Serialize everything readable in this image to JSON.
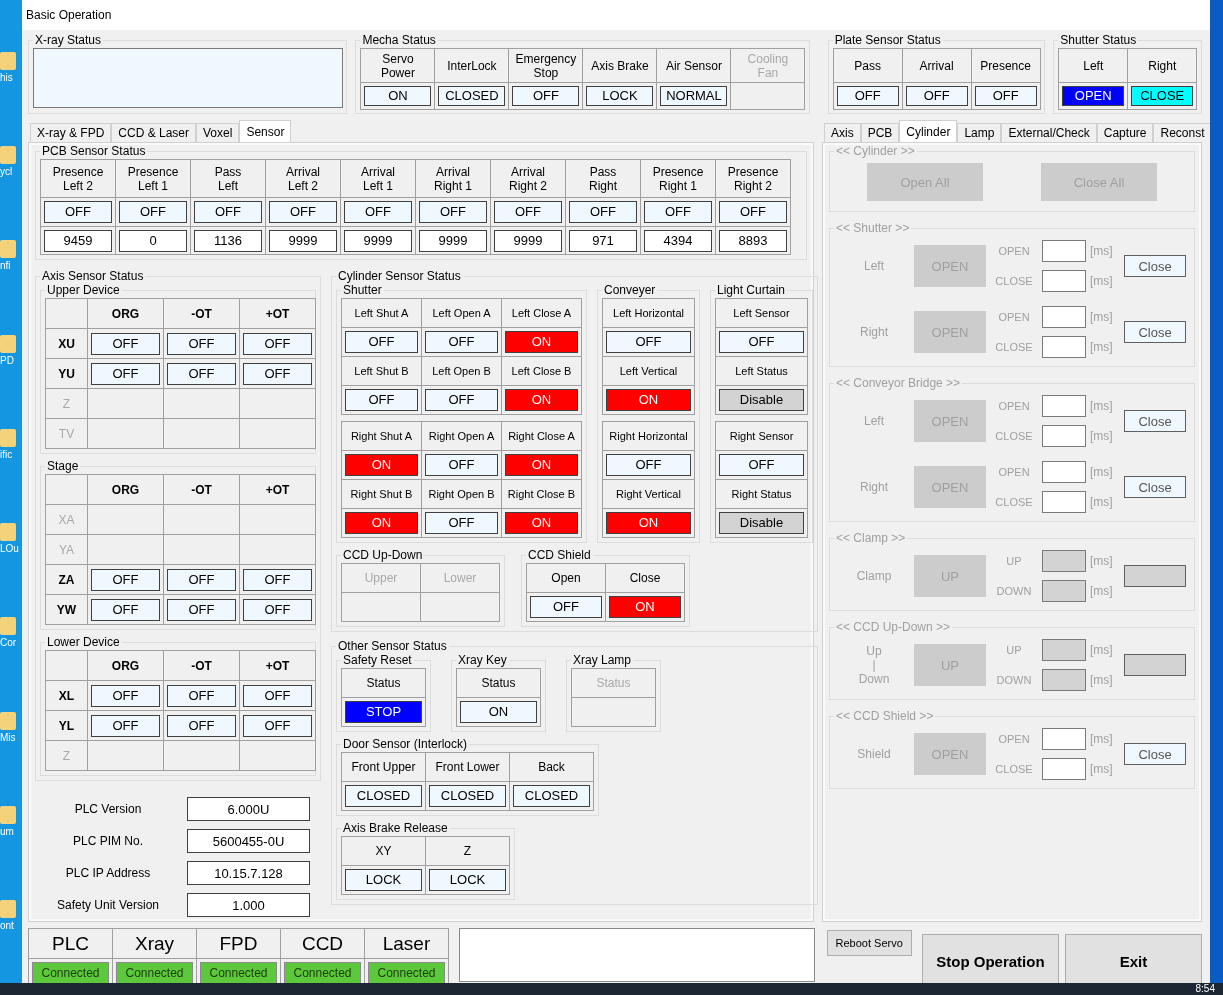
{
  "window": {
    "title": "Basic Operation"
  },
  "desktop": {
    "icon_labels": [
      "his",
      "ycl",
      "nfi",
      "PD",
      "ific",
      "LOu",
      "Cor",
      "Mis",
      "um",
      "ont"
    ]
  },
  "xray_status": {
    "title": "X-ray Status"
  },
  "mecha_status": {
    "title": "Mecha Status",
    "columns": [
      {
        "label": "Servo\nPower",
        "disabled": false,
        "indicator": {
          "text": "ON",
          "color": "#f0f8ff"
        }
      },
      {
        "label": "InterLock",
        "disabled": false,
        "indicator": {
          "text": "CLOSED",
          "color": "#f0f8ff"
        }
      },
      {
        "label": "Emergency\nStop",
        "disabled": false,
        "indicator": {
          "text": "OFF",
          "color": "#f0f8ff"
        }
      },
      {
        "label": "Axis Brake",
        "disabled": false,
        "indicator": {
          "text": "LOCK",
          "color": "#f0f8ff"
        }
      },
      {
        "label": "Air Sensor",
        "disabled": false,
        "indicator": {
          "text": "NORMAL",
          "color": "#f0f8ff"
        }
      },
      {
        "label": "Cooling\nFan",
        "disabled": true
      }
    ]
  },
  "plate_sensor_status": {
    "title": "Plate Sensor Status",
    "columns": [
      {
        "label": "Pass",
        "indicator": {
          "text": "OFF",
          "color": "#f0f8ff"
        }
      },
      {
        "label": "Arrival",
        "indicator": {
          "text": "OFF",
          "color": "#f0f8ff"
        }
      },
      {
        "label": "Presence",
        "indicator": {
          "text": "OFF",
          "color": "#f0f8ff"
        }
      }
    ]
  },
  "shutter_status": {
    "title": "Shutter Status",
    "columns": [
      {
        "label": "Left",
        "indicator": {
          "text": "OPEN",
          "color": "#0000ff"
        }
      },
      {
        "label": "Right",
        "indicator": {
          "text": "CLOSE",
          "color": "#00ffff"
        }
      }
    ]
  },
  "left_tabs": [
    {
      "label": "X-ray & FPD",
      "selected": false
    },
    {
      "label": "CCD & Laser",
      "selected": false
    },
    {
      "label": "Voxel",
      "selected": false
    },
    {
      "label": "Sensor",
      "selected": true
    }
  ],
  "pcb_sensor_status": {
    "title": "PCB Sensor Status",
    "columns": [
      {
        "label": "Presence\nLeft 2",
        "indicator": {
          "text": "OFF",
          "color": "#f0f8ff"
        },
        "value": "9459"
      },
      {
        "label": "Presence\nLeft 1",
        "indicator": {
          "text": "OFF",
          "color": "#f0f8ff"
        },
        "value": "0"
      },
      {
        "label": "Pass\nLeft",
        "indicator": {
          "text": "OFF",
          "color": "#f0f8ff"
        },
        "value": "1136"
      },
      {
        "label": "Arrival\nLeft 2",
        "indicator": {
          "text": "OFF",
          "color": "#f0f8ff"
        },
        "value": "9999"
      },
      {
        "label": "Arrival\nLeft 1",
        "indicator": {
          "text": "OFF",
          "color": "#f0f8ff"
        },
        "value": "9999"
      },
      {
        "label": "Arrival\nRight 1",
        "indicator": {
          "text": "OFF",
          "color": "#f0f8ff"
        },
        "value": "9999"
      },
      {
        "label": "Arrival\nRight 2",
        "indicator": {
          "text": "OFF",
          "color": "#f0f8ff"
        },
        "value": "9999"
      },
      {
        "label": "Pass\nRight",
        "indicator": {
          "text": "OFF",
          "color": "#f0f8ff"
        },
        "value": "971"
      },
      {
        "label": "Presence\nRight 1",
        "indicator": {
          "text": "OFF",
          "color": "#f0f8ff"
        },
        "value": "4394"
      },
      {
        "label": "Presence\nRight 2",
        "indicator": {
          "text": "OFF",
          "color": "#f0f8ff"
        },
        "value": "8893"
      }
    ]
  },
  "axis_sensor_status": {
    "title": "Axis Sensor Status",
    "groups": [
      {
        "title": "Upper Device",
        "headers": [
          "ORG",
          "-OT",
          "+OT"
        ],
        "rows": [
          {
            "axis": "XU",
            "disabled": false,
            "values": [
              {
                "text": "OFF",
                "color": "#f0f8ff"
              },
              {
                "text": "OFF",
                "color": "#f0f8ff"
              },
              {
                "text": "OFF",
                "color": "#f0f8ff"
              }
            ]
          },
          {
            "axis": "YU",
            "disabled": false,
            "values": [
              {
                "text": "OFF",
                "color": "#f0f8ff"
              },
              {
                "text": "OFF",
                "color": "#f0f8ff"
              },
              {
                "text": "OFF",
                "color": "#f0f8ff"
              }
            ]
          },
          {
            "axis": "Z",
            "disabled": true
          },
          {
            "axis": "TV",
            "disabled": true
          }
        ]
      },
      {
        "title": "Stage",
        "headers": [
          "ORG",
          "-OT",
          "+OT"
        ],
        "rows": [
          {
            "axis": "XA",
            "disabled": true
          },
          {
            "axis": "YA",
            "disabled": true
          },
          {
            "axis": "ZA",
            "disabled": false,
            "values": [
              {
                "text": "OFF",
                "color": "#f0f8ff"
              },
              {
                "text": "OFF",
                "color": "#f0f8ff"
              },
              {
                "text": "OFF",
                "color": "#f0f8ff"
              }
            ]
          },
          {
            "axis": "YW",
            "disabled": false,
            "values": [
              {
                "text": "OFF",
                "color": "#f0f8ff"
              },
              {
                "text": "OFF",
                "color": "#f0f8ff"
              },
              {
                "text": "OFF",
                "color": "#f0f8ff"
              }
            ]
          }
        ]
      },
      {
        "title": "Lower Device",
        "headers": [
          "ORG",
          "-OT",
          "+OT"
        ],
        "rows": [
          {
            "axis": "XL",
            "disabled": false,
            "values": [
              {
                "text": "OFF",
                "color": "#f0f8ff"
              },
              {
                "text": "OFF",
                "color": "#f0f8ff"
              },
              {
                "text": "OFF",
                "color": "#f0f8ff"
              }
            ]
          },
          {
            "axis": "YL",
            "disabled": false,
            "values": [
              {
                "text": "OFF",
                "color": "#f0f8ff"
              },
              {
                "text": "OFF",
                "color": "#f0f8ff"
              },
              {
                "text": "OFF",
                "color": "#f0f8ff"
              }
            ]
          },
          {
            "axis": "Z",
            "disabled": true
          }
        ]
      }
    ]
  },
  "plc_info": [
    {
      "label": "PLC Version",
      "value": "6.000U"
    },
    {
      "label": "PLC PIM No.",
      "value": "5600455-0U"
    },
    {
      "label": "PLC IP Address",
      "value": "10.15.7.128"
    },
    {
      "label": "Safety Unit Version",
      "value": "1.000"
    }
  ],
  "cylinder_sensor_status": {
    "title": "Cylinder Sensor Status",
    "groups": [
      {
        "title": "Shutter",
        "blocks": [
          [
            [
              {
                "label": "Left Shut A",
                "indicator": {
                  "text": "OFF",
                  "color": "#f0f8ff"
                }
              },
              {
                "label": "Left Open A",
                "indicator": {
                  "text": "OFF",
                  "color": "#f0f8ff"
                }
              },
              {
                "label": "Left Close A",
                "indicator": {
                  "text": "ON",
                  "color": "#ff0000"
                }
              }
            ],
            [
              {
                "label": "Left Shut B",
                "indicator": {
                  "text": "OFF",
                  "color": "#f0f8ff"
                }
              },
              {
                "label": "Left Open B",
                "indicator": {
                  "text": "OFF",
                  "color": "#f0f8ff"
                }
              },
              {
                "label": "Left Close B",
                "indicator": {
                  "text": "ON",
                  "color": "#ff0000"
                }
              }
            ]
          ],
          [
            [
              {
                "label": "Right Shut A",
                "indicator": {
                  "text": "ON",
                  "color": "#ff0000"
                }
              },
              {
                "label": "Right Open A",
                "indicator": {
                  "text": "OFF",
                  "color": "#f0f8ff"
                }
              },
              {
                "label": "Right Close A",
                "indicator": {
                  "text": "ON",
                  "color": "#ff0000"
                }
              }
            ],
            [
              {
                "label": "Right Shut B",
                "indicator": {
                  "text": "ON",
                  "color": "#ff0000"
                }
              },
              {
                "label": "Right Open B",
                "indicator": {
                  "text": "OFF",
                  "color": "#f0f8ff"
                }
              },
              {
                "label": "Right Close B",
                "indicator": {
                  "text": "ON",
                  "color": "#ff0000"
                }
              }
            ]
          ]
        ]
      },
      {
        "title": "Conveyer",
        "blocks": [
          [
            [
              {
                "label": "Left Horizontal",
                "indicator": {
                  "text": "OFF",
                  "color": "#f0f8ff"
                }
              }
            ],
            [
              {
                "label": "Left Vertical",
                "indicator": {
                  "text": "ON",
                  "color": "#ff0000"
                }
              }
            ]
          ],
          [
            [
              {
                "label": "Right Horizontal",
                "indicator": {
                  "text": "OFF",
                  "color": "#f0f8ff"
                }
              }
            ],
            [
              {
                "label": "Right Vertical",
                "indicator": {
                  "text": "ON",
                  "color": "#ff0000"
                }
              }
            ]
          ]
        ]
      },
      {
        "title": "Light Curtain",
        "blocks": [
          [
            [
              {
                "label": "Left Sensor",
                "indicator": {
                  "text": "OFF",
                  "color": "#f0f8ff"
                }
              }
            ],
            [
              {
                "label": "Left Status",
                "indicator": {
                  "text": "Disable",
                  "color": "#d3d3d3"
                }
              }
            ]
          ],
          [
            [
              {
                "label": "Right Sensor",
                "indicator": {
                  "text": "OFF",
                  "color": "#f0f8ff"
                }
              }
            ],
            [
              {
                "label": "Right Status",
                "indicator": {
                  "text": "Disable",
                  "color": "#d3d3d3"
                }
              }
            ]
          ]
        ]
      }
    ]
  },
  "ccd_up_down": {
    "title": "CCD Up-Down",
    "columns": [
      {
        "label": "Upper",
        "disabled": true
      },
      {
        "label": "Lower",
        "disabled": true
      }
    ]
  },
  "ccd_shield": {
    "title": "CCD Shield",
    "columns": [
      {
        "label": "Open",
        "indicator": {
          "text": "OFF",
          "color": "#f0f8ff"
        }
      },
      {
        "label": "Close",
        "indicator": {
          "text": "ON",
          "color": "#ff0000"
        }
      }
    ]
  },
  "other_sensor_status": {
    "title": "Other Sensor Status",
    "groups": [
      {
        "title": "Safety Reset",
        "columns": [
          {
            "label": "Status",
            "disabled": false,
            "indicator": {
              "text": "STOP",
              "color": "#0000ff"
            }
          }
        ]
      },
      {
        "title": "Xray Key",
        "columns": [
          {
            "label": "Status",
            "disabled": false,
            "indicator": {
              "text": "ON",
              "color": "#f0f8ff"
            }
          }
        ]
      },
      {
        "title": "Xray Lamp",
        "columns": [
          {
            "label": "Status",
            "disabled": true
          }
        ]
      },
      {
        "title": "Door Sensor (Interlock)",
        "columns": [
          {
            "label": "Front Upper",
            "indicator": {
              "text": "CLOSED",
              "color": "#f0f8ff"
            }
          },
          {
            "label": "Front Lower",
            "indicator": {
              "text": "CLOSED",
              "color": "#f0f8ff"
            }
          },
          {
            "label": "Back",
            "indicator": {
              "text": "CLOSED",
              "color": "#f0f8ff"
            }
          }
        ]
      },
      {
        "title": "Axis Brake Release",
        "columns": [
          {
            "label": "XY",
            "indicator": {
              "text": "LOCK",
              "color": "#f0f8ff"
            }
          },
          {
            "label": "Z",
            "indicator": {
              "text": "LOCK",
              "color": "#f0f8ff"
            }
          }
        ]
      }
    ]
  },
  "right_tabs": [
    {
      "label": "Axis",
      "selected": false
    },
    {
      "label": "PCB",
      "selected": false
    },
    {
      "label": "Cylinder",
      "selected": true
    },
    {
      "label": "Lamp",
      "selected": false
    },
    {
      "label": "External/Check",
      "selected": false
    },
    {
      "label": "Capture",
      "selected": false
    },
    {
      "label": "Reconst",
      "selected": false
    }
  ],
  "cylinder_panel": [
    {
      "title": "<< Cylinder >>",
      "kind": "buttons",
      "buttons": [
        {
          "text": "Open All",
          "disabled": true
        },
        {
          "text": "Close All",
          "disabled": true
        }
      ]
    },
    {
      "title": "<< Shutter >>",
      "kind": "rows",
      "rows": [
        {
          "label": "Left",
          "action": {
            "text": "OPEN",
            "disabled": true
          },
          "fields": [
            {
              "label": "OPEN",
              "unit": "[ms]",
              "disabled": false
            },
            {
              "label": "CLOSE",
              "unit": "[ms]",
              "disabled": false
            }
          ],
          "button": {
            "text": "Close",
            "disabled": false
          }
        },
        {
          "label": "Right",
          "action": {
            "text": "OPEN",
            "disabled": true
          },
          "fields": [
            {
              "label": "OPEN",
              "unit": "[ms]",
              "disabled": false
            },
            {
              "label": "CLOSE",
              "unit": "[ms]",
              "disabled": false
            }
          ],
          "button": {
            "text": "Close",
            "disabled": false
          }
        }
      ]
    },
    {
      "title": "<< Conveyor Bridge >>",
      "kind": "rows",
      "rows": [
        {
          "label": "Left",
          "action": {
            "text": "OPEN",
            "disabled": true
          },
          "fields": [
            {
              "label": "OPEN",
              "unit": "[ms]",
              "disabled": false
            },
            {
              "label": "CLOSE",
              "unit": "[ms]",
              "disabled": false
            }
          ],
          "button": {
            "text": "Close",
            "disabled": false
          }
        },
        {
          "label": "Right",
          "action": {
            "text": "OPEN",
            "disabled": true
          },
          "fields": [
            {
              "label": "OPEN",
              "unit": "[ms]",
              "disabled": false
            },
            {
              "label": "CLOSE",
              "unit": "[ms]",
              "disabled": false
            }
          ],
          "button": {
            "text": "Close",
            "disabled": false
          }
        }
      ]
    },
    {
      "title": "<< Clamp >>",
      "kind": "rows",
      "rows": [
        {
          "label": "Clamp",
          "action": {
            "text": "UP",
            "disabled": true
          },
          "fields": [
            {
              "label": "UP",
              "unit": "[ms]",
              "disabled": true
            },
            {
              "label": "DOWN",
              "unit": "[ms]",
              "disabled": true
            }
          ],
          "button": {
            "disabled": true
          }
        }
      ]
    },
    {
      "title": "<< CCD Up-Down >>",
      "kind": "rows",
      "rows": [
        {
          "label": "Up\n|\nDown",
          "action": {
            "text": "UP",
            "disabled": true
          },
          "fields": [
            {
              "label": "UP",
              "unit": "[ms]",
              "disabled": true
            },
            {
              "label": "DOWN",
              "unit": "[ms]",
              "disabled": true
            }
          ],
          "button": {
            "disabled": true
          }
        }
      ]
    },
    {
      "title": "<< CCD Shield >>",
      "kind": "rows",
      "rows": [
        {
          "label": "Shield",
          "action": {
            "text": "OPEN",
            "disabled": true
          },
          "fields": [
            {
              "label": "OPEN",
              "unit": "[ms]",
              "disabled": false
            },
            {
              "label": "CLOSE",
              "unit": "[ms]",
              "disabled": false
            }
          ],
          "button": {
            "text": "Close",
            "disabled": false
          }
        }
      ]
    }
  ],
  "connections": [
    {
      "name": "PLC",
      "status": "Connected"
    },
    {
      "name": "Xray",
      "status": "Connected"
    },
    {
      "name": "FPD",
      "status": "Connected"
    },
    {
      "name": "CCD",
      "status": "Connected"
    },
    {
      "name": "Laser",
      "status": "Connected"
    }
  ],
  "buttons": [
    {
      "text": "Reboot Servo",
      "kind": "small"
    },
    {
      "text": "Stop Operation",
      "kind": "large"
    },
    {
      "text": "Exit",
      "kind": "large"
    }
  ],
  "taskbar": {
    "time": "8:54"
  }
}
